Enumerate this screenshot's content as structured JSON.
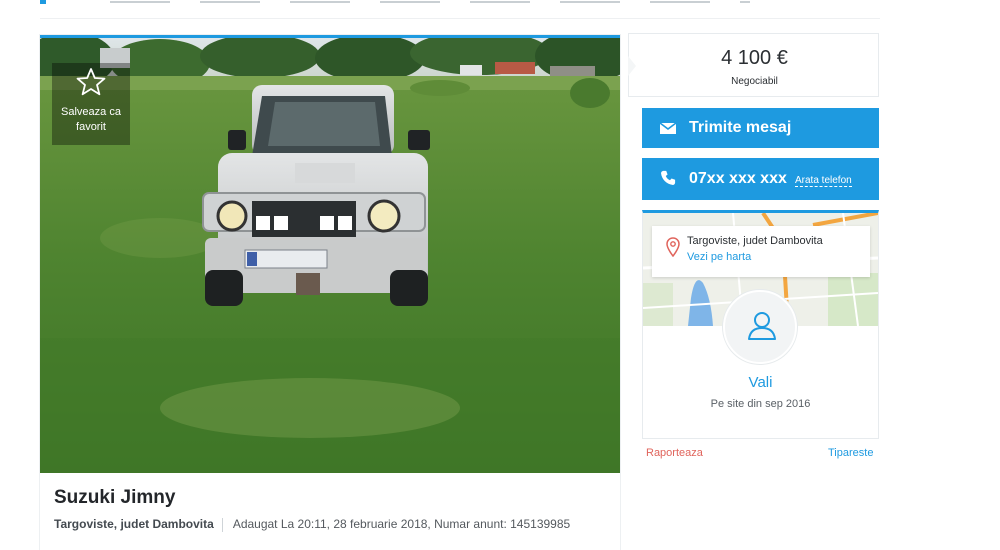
{
  "favorite": {
    "label": "Salveaza ca favorit",
    "icon": "star-outline-icon"
  },
  "ad": {
    "title": "Suzuki Jimny",
    "location": "Targoviste, judet Dambovita",
    "added": "Adaugat La 20:11, 28 februarie 2018, Numar anunt: 145139985"
  },
  "price": {
    "amount": "4 100 €",
    "note": "Negociabil"
  },
  "actions": {
    "message_label": "Trimite mesaj",
    "message_icon": "envelope-icon",
    "phone_number": "07xx xxx xxx",
    "phone_icon": "phone-icon",
    "show_phone_label": "Arata telefon"
  },
  "seller": {
    "city": "Targoviste, judet Dambovita",
    "map_link": "Vezi pe harta",
    "name": "Vali",
    "member_since": "Pe site din sep 2016",
    "avatar_icon": "user-icon",
    "pin_icon": "map-pin-icon"
  },
  "footer_links": {
    "report": "Raporteaza",
    "print": "Tipareste"
  },
  "colors": {
    "accent": "#1e9ae0",
    "price_text": "#2b2f33",
    "report": "#e0645c"
  }
}
